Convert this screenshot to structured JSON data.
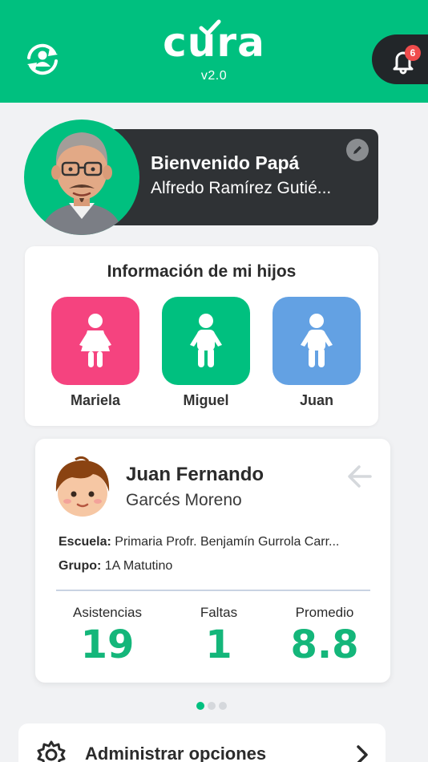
{
  "header": {
    "logo_text": "cura",
    "version": "v2.0",
    "notification_count": "6",
    "switch_icon": "user-sync-icon",
    "bell_icon": "bell-icon"
  },
  "welcome": {
    "title": "Bienvenido Papá",
    "name": "Alfredo Ramírez Gutié..."
  },
  "kids": {
    "title": "Información de mi hijos",
    "items": [
      {
        "name": "Mariela",
        "color": "#f5437f"
      },
      {
        "name": "Miguel",
        "color": "#00c07f"
      },
      {
        "name": "Juan",
        "color": "#63a1e3"
      }
    ]
  },
  "student": {
    "first_name": "Juan Fernando",
    "last_name": "Garcés Moreno",
    "school_label": "Escuela:",
    "school_value": "Primaria Profr. Benjamín Gurrola Carr...",
    "group_label": "Grupo:",
    "group_value": "1A Matutino",
    "stats": [
      {
        "label": "Asistencias",
        "value": "19"
      },
      {
        "label": "Faltas",
        "value": "1"
      },
      {
        "label": "Promedio",
        "value": "8.8"
      }
    ]
  },
  "options": {
    "label": "Administrar opciones"
  },
  "colors": {
    "brand": "#00c07f",
    "dark": "#2f3235",
    "accent_value": "#14b67a",
    "badge": "#f04c4c"
  }
}
